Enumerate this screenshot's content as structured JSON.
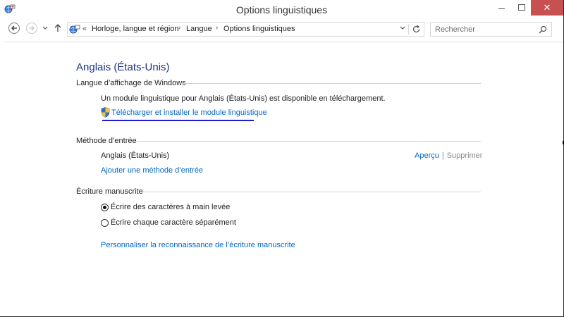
{
  "window": {
    "title": "Options linguistiques",
    "close_glyph": "✕"
  },
  "nav": {
    "breadcrumb": [
      "Horloge, langue et région",
      "Langue",
      "Options linguistiques"
    ],
    "search_placeholder": "Rechercher"
  },
  "content": {
    "heading": "Anglais (États-Unis)",
    "display_language": {
      "label": "Langue d’affichage de Windows",
      "availability_text": "Un module linguistique pour Anglais (États-Unis) est disponible en téléchargement.",
      "download_link": "Télécharger et installer le module linguistique"
    },
    "input_method": {
      "label": "Méthode d’entrée",
      "method_name": "Anglais (États-Unis)",
      "preview_link": "Aperçu",
      "separator": "|",
      "remove_link": "Supprimer",
      "add_link": "Ajouter une méthode d’entrée"
    },
    "handwriting": {
      "label": "Écriture manuscrite",
      "options": [
        {
          "label": "Écrire des caractères à main levée",
          "checked": true
        },
        {
          "label": "Écrire chaque caractère séparément",
          "checked": false
        }
      ],
      "customize_link": "Personnaliser la reconnaissance de l’écriture manuscrite"
    }
  },
  "colors": {
    "heading": "#1e3287",
    "link": "#0066cc",
    "close_button": "#c75050",
    "focus_underline": "#1c1cd6"
  },
  "icons": {
    "app": "language-globe-icon",
    "shield": "uac-shield-icon",
    "search": "magnifier-icon",
    "refresh": "refresh-icon"
  }
}
